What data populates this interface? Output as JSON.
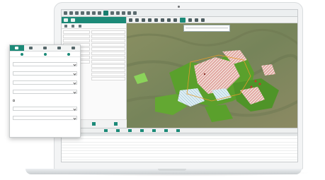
{
  "colors": {
    "accent": "#1c8a78",
    "map_terrain": "#7c8a5b",
    "map_forest": "#5aa02c",
    "map_hatch": "#c94a4a",
    "map_light": "#c8e3ef"
  },
  "icons": {
    "main_toolbar": [
      "folder-icon",
      "save-icon",
      "pencil-icon",
      "layers-icon",
      "search-icon",
      "zoom-in-icon",
      "zoom-out-icon",
      "pan-icon",
      "measure-icon",
      "print-icon",
      "settings-icon"
    ],
    "map_toolbar": [
      "select-icon",
      "zoom-in-icon",
      "zoom-out-icon",
      "home-icon",
      "info-icon",
      "measure-icon",
      "draw-icon",
      "layers-icon",
      "print-icon",
      "refresh-icon"
    ],
    "filter_tabs": [
      "search-icon",
      "layers-icon",
      "table-icon",
      "calendar-icon",
      "grid-icon"
    ]
  },
  "filter_panel": {
    "fields": [
      {
        "label": "",
        "value": ""
      },
      {
        "label": "",
        "value": ""
      },
      {
        "label": "",
        "value": ""
      },
      {
        "label": "",
        "value": ""
      },
      {
        "label": "",
        "value": ""
      },
      {
        "label": "",
        "value": ""
      },
      {
        "label": "",
        "value": ""
      }
    ]
  },
  "map": {
    "popup_text": ""
  }
}
